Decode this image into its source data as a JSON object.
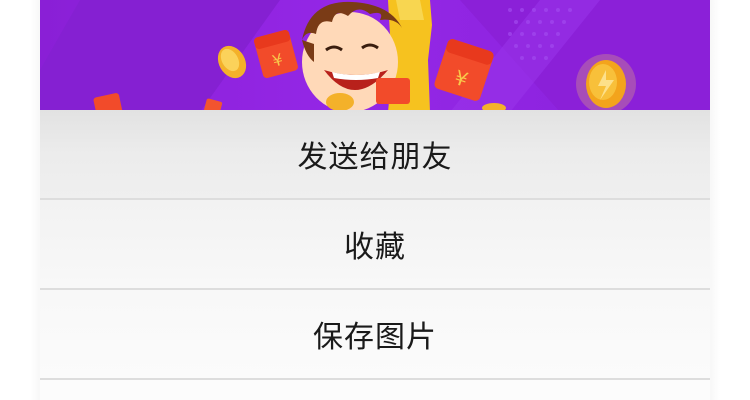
{
  "share_sheet": {
    "items": [
      {
        "label": "发送给朋友"
      },
      {
        "label": "收藏"
      },
      {
        "label": "保存图片"
      },
      {
        "label": ""
      }
    ]
  },
  "colors": {
    "banner_purple": "#8f24e0",
    "red_packet": "#f24b2a",
    "coin_gold": "#f6b52a",
    "sheet_background": "#f2f2f2",
    "divider": "#dddddd",
    "label_text": "#1a1a1a"
  },
  "banner": {
    "icons": [
      "cartoon-boy-icon",
      "red-packet-icon",
      "gold-coin-icon",
      "yuan-symbol-icon"
    ]
  }
}
